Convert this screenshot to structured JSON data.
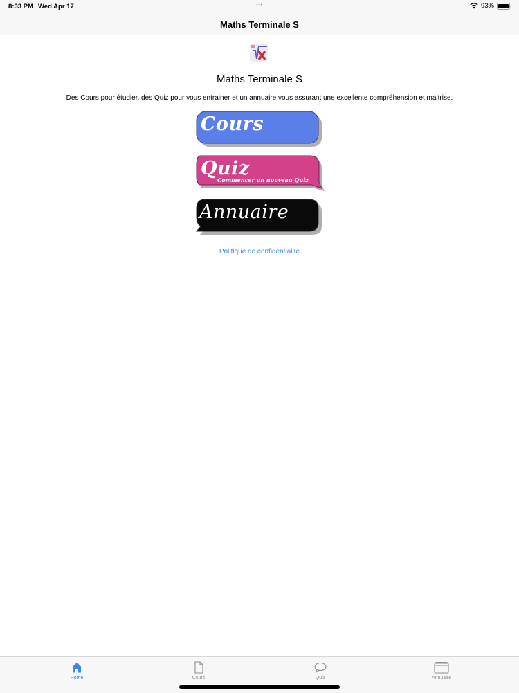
{
  "status": {
    "time": "8:33 PM",
    "date": "Wed Apr 17",
    "battery": "93%"
  },
  "nav": {
    "title": "Maths Terminale S"
  },
  "main": {
    "title": "Maths Terminale S",
    "description": "Des Cours pour étudier, des Quiz pour vous entrainer et un annuaire vous assurant une excellente compréhension et maitrise.",
    "buttons": [
      {
        "label": "Cours",
        "color": "#5b7fe8"
      },
      {
        "label": "Quiz",
        "subtitle": "Commencer un nouveau Quiz",
        "color": "#d2418a"
      },
      {
        "label": "Annuaire",
        "color": "#0a0a0a"
      }
    ],
    "privacy_link": "Politique de confidentialite"
  },
  "tabbar": {
    "items": [
      {
        "label": "Home",
        "icon": "house-icon",
        "active": true
      },
      {
        "label": "Cours",
        "icon": "document-icon",
        "active": false
      },
      {
        "label": "Quiz",
        "icon": "speech-bubble-icon",
        "active": false
      },
      {
        "label": "Annuaire",
        "icon": "folder-icon",
        "active": false
      }
    ]
  },
  "colors": {
    "accent": "#3c84f0",
    "link": "#4a8ae8"
  }
}
